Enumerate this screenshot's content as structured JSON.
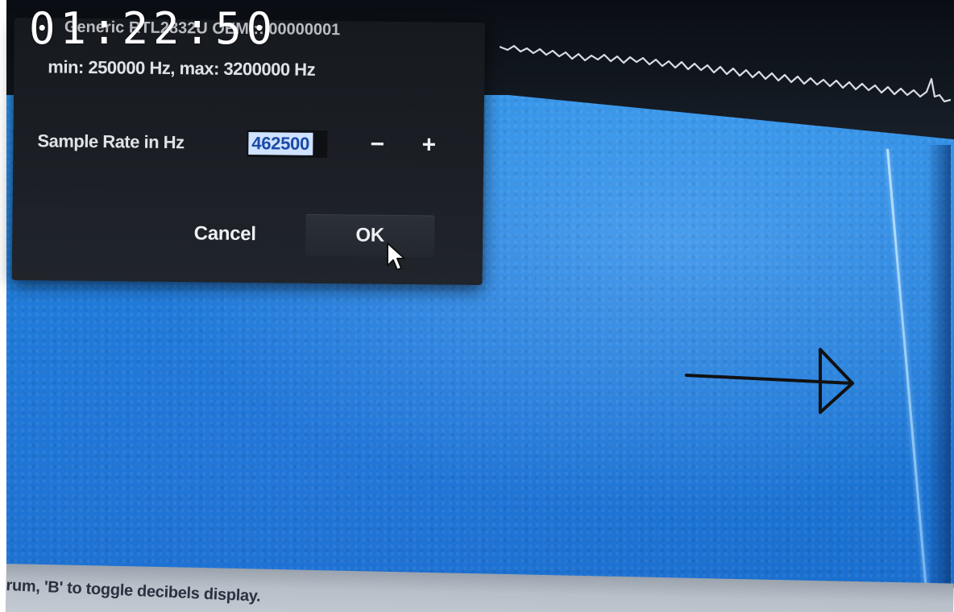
{
  "overlay": {
    "timestamp": "01:22:50"
  },
  "dialog": {
    "header": "Generic RTL2832U OEM :: 00000001",
    "range_text": "min: 250000 Hz, max: 3200000 Hz",
    "sample_rate_label": "Sample Rate in Hz",
    "sample_rate_value": "462500",
    "decrement_label": "−",
    "increment_label": "+",
    "cancel_label": "Cancel",
    "ok_label": "OK"
  },
  "status_bar": {
    "text": "rum, 'B' to toggle decibels display."
  },
  "colors": {
    "waterfall_blue": "#1f7cd9",
    "dialog_bg": "#1c2026",
    "selection_bg": "#cfe2ff",
    "selection_text": "#1b4aa6"
  },
  "icons": {
    "cursor": "mouse-pointer-icon",
    "annotation": "arrow-right-icon"
  }
}
